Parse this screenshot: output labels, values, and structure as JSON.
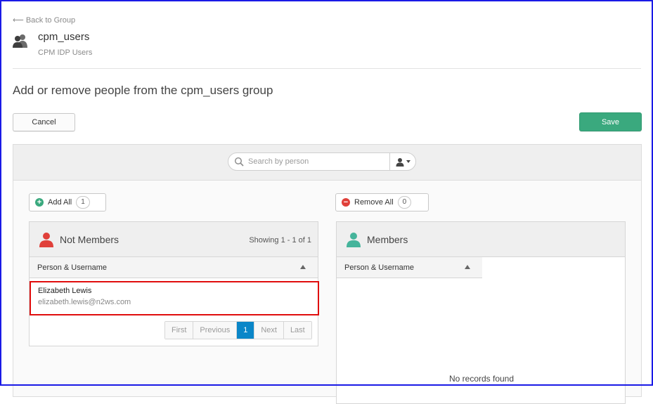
{
  "nav": {
    "back_label": "⟵ Back to Group"
  },
  "group": {
    "name": "cpm_users",
    "description": "CPM IDP Users"
  },
  "page": {
    "heading": "Add or remove people from the cpm_users group"
  },
  "actions": {
    "cancel_label": "Cancel",
    "save_label": "Save"
  },
  "search": {
    "placeholder": "Search by person"
  },
  "add_all": {
    "label": "Add All",
    "count": "1"
  },
  "remove_all": {
    "label": "Remove All",
    "count": "0"
  },
  "not_members": {
    "title": "Not Members",
    "showing": "Showing 1 - 1 of 1",
    "column": "Person & Username",
    "rows": [
      {
        "name": "Elizabeth Lewis",
        "email": "elizabeth.lewis@n2ws.com"
      }
    ],
    "pager": {
      "first": "First",
      "previous": "Previous",
      "current": "1",
      "next": "Next",
      "last": "Last"
    }
  },
  "members": {
    "title": "Members",
    "column": "Person & Username",
    "empty_text": "No records found"
  },
  "colors": {
    "accent_green": "#3aa97e",
    "danger_red": "#e0403a",
    "member_teal": "#45b49b",
    "page_blue": "#0a86c8",
    "highlight": "#e00d0d"
  },
  "icons": [
    "group-icon",
    "search-icon",
    "person-filter-icon",
    "add-icon",
    "remove-icon",
    "not-member-icon",
    "member-icon",
    "sort-asc-icon"
  ]
}
